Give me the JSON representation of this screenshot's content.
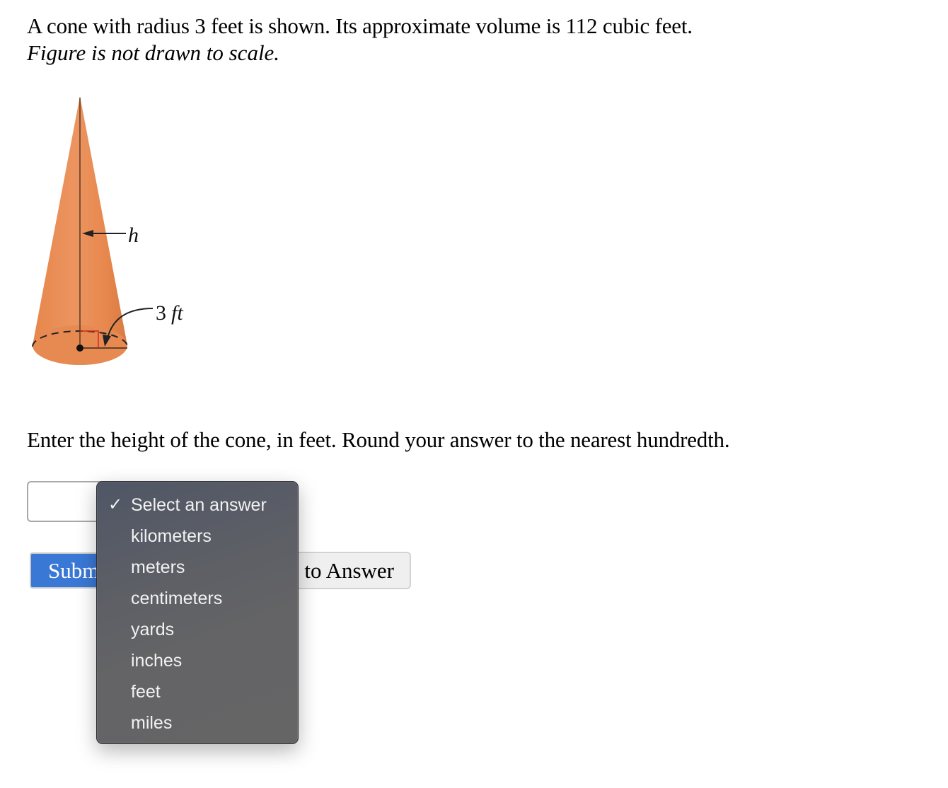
{
  "question": {
    "line1": "A cone with radius 3 feet is shown. Its approximate volume is 112 cubic feet.",
    "line2": "Figure is not drawn to scale."
  },
  "figure": {
    "height_label": "h",
    "radius_label_number": "3",
    "radius_label_unit": "ft",
    "cone_color": "#e8874f"
  },
  "prompt": "Enter the height of the cone, in feet. Round your answer to the nearest hundredth.",
  "answer_input": {
    "value": "",
    "placeholder": ""
  },
  "unit_dropdown": {
    "selected": "Select an answer",
    "check_icon": "✓",
    "options": [
      {
        "label": "Select an answer",
        "checked": true
      },
      {
        "label": "kilometers",
        "checked": false
      },
      {
        "label": "meters",
        "checked": false
      },
      {
        "label": "centimeters",
        "checked": false
      },
      {
        "label": "yards",
        "checked": false
      },
      {
        "label": "inches",
        "checked": false
      },
      {
        "label": "feet",
        "checked": false
      },
      {
        "label": "miles",
        "checked": false
      }
    ]
  },
  "buttons": {
    "submit_label": "Subm",
    "skip_label": "to Answer",
    "submit_color": "#3a78d6"
  }
}
